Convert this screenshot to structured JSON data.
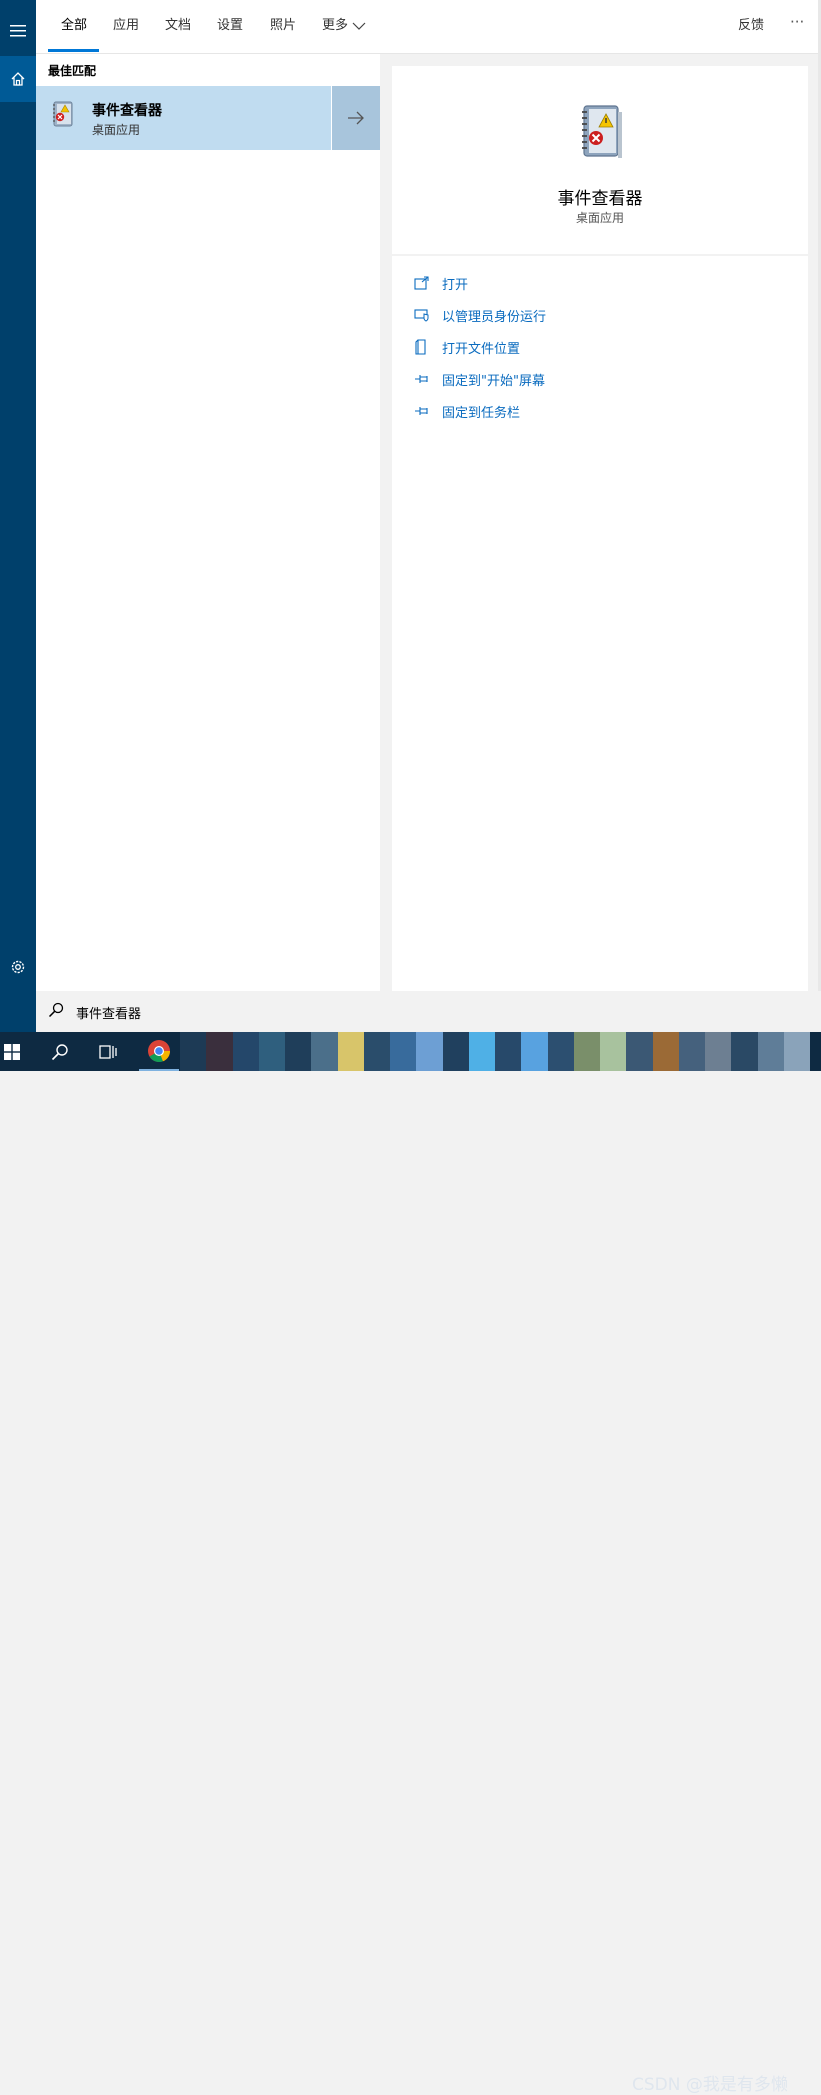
{
  "tabs": [
    {
      "label": "全部",
      "active": true
    },
    {
      "label": "应用"
    },
    {
      "label": "文档"
    },
    {
      "label": "设置"
    },
    {
      "label": "照片"
    },
    {
      "label": "更多"
    }
  ],
  "header": {
    "feedback": "反馈",
    "more": "···"
  },
  "results": {
    "section_title": "最佳匹配",
    "best_match": {
      "name": "事件查看器",
      "type": "桌面应用"
    }
  },
  "detail": {
    "name": "事件查看器",
    "type": "桌面应用",
    "actions": [
      {
        "label": "打开",
        "icon": "open-icon"
      },
      {
        "label": "以管理员身份运行",
        "icon": "shield-icon"
      },
      {
        "label": "打开文件位置",
        "icon": "file-location-icon"
      },
      {
        "label": "固定到\"开始\"屏幕",
        "icon": "pin-icon"
      },
      {
        "label": "固定到任务栏",
        "icon": "pin-icon"
      }
    ]
  },
  "search": {
    "value": "事件查看器"
  },
  "watermark": "CSDN @我是有多懒",
  "colors": {
    "accent": "#0078d7",
    "rail": "#00406b",
    "selected": "#c0dcf0",
    "taskbar": "#0e2a42"
  }
}
